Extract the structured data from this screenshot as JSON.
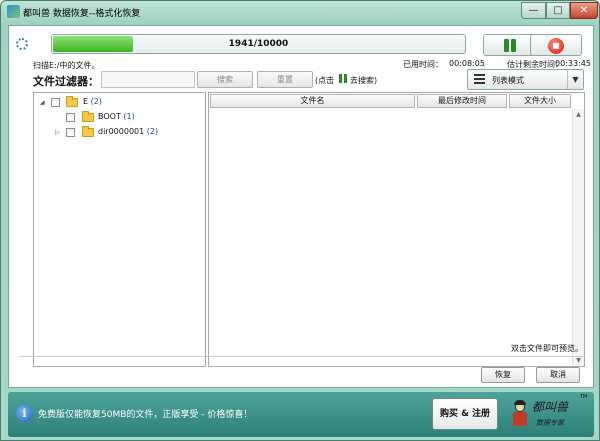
{
  "window": {
    "title": "都叫兽 数据恢复--格式化恢复",
    "ghost_title": "Rene E Lab",
    "minimize_glyph": "—",
    "maximize_glyph": "□",
    "close_glyph": "✕"
  },
  "scan": {
    "progress_text": "1941/10000",
    "progress_fraction": 0.1941,
    "status_text": "扫描E:/中的文件。",
    "elapsed_label": "已用时间：",
    "elapsed_value": "00:08:05",
    "remaining_label": "估计剩余时间：",
    "remaining_value": "00:33:45"
  },
  "filter": {
    "label": "文件过滤器：",
    "input_value": "",
    "search_label": "搜索",
    "reset_label": "重置",
    "hint_prefix": "(点击",
    "hint_suffix": "去搜索)"
  },
  "view": {
    "mode_label": "列表模式",
    "arrow_glyph": "▼"
  },
  "tree": {
    "items": [
      {
        "name": "E",
        "count": "(2)",
        "expander": "◢"
      },
      {
        "name": "BOOT",
        "count": "(1)",
        "expander": ""
      },
      {
        "name": "dir0000001",
        "count": "(2)",
        "expander": "▷"
      }
    ]
  },
  "file_list": {
    "columns": [
      "文件名",
      "最后修改时间",
      "文件大小"
    ],
    "rows": [],
    "scroll_up_glyph": "▲",
    "scroll_down_glyph": "▼"
  },
  "hints": {
    "double_click_preview": "双击文件即可预览。"
  },
  "actions": {
    "recover_label": "恢复",
    "cancel_label": "取消"
  },
  "bottom": {
    "info_glyph": "i",
    "promo_text": "免费版仅能恢复50MB的文件，正版享受 - 价格惊喜！",
    "buy_label": "购买 & 注册",
    "logo_title": "都叫兽",
    "logo_subtitle": "数据专家",
    "logo_tm": "TM"
  },
  "colors": {
    "frame": "#a6d6c6",
    "progress_fill": "#3db31e",
    "pause_green": "#2a8a2a",
    "stop_red": "#d21a0a",
    "bottom_bar": "#2c7f77",
    "count_blue": "#1f3fb5"
  },
  "icons": {
    "app": "app-icon",
    "spinner": "loading-spinner-icon",
    "pause": "pause-icon",
    "stop": "stop-icon",
    "list": "list-view-icon",
    "folder": "folder-icon",
    "info": "info-icon"
  }
}
